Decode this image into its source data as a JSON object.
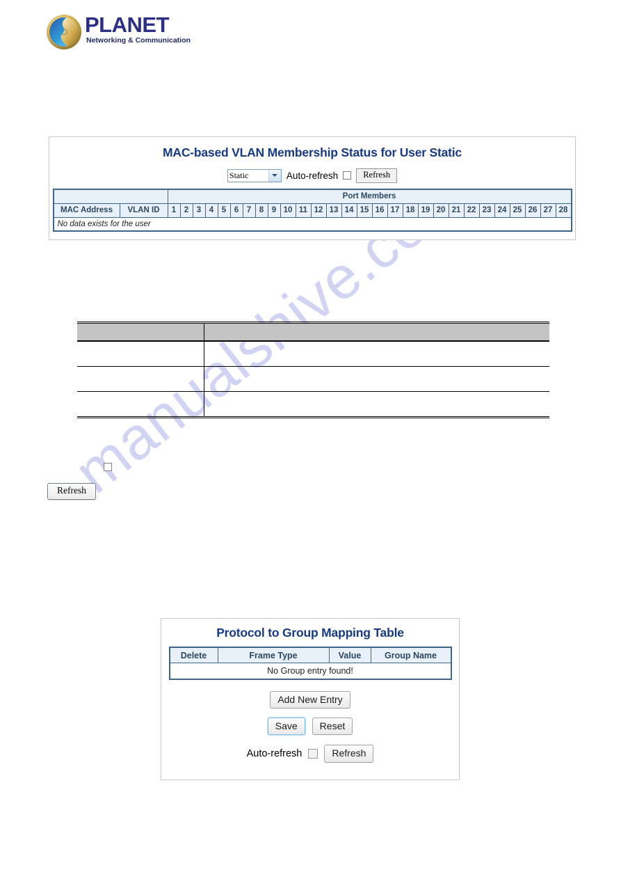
{
  "brand": {
    "name": "PLANET",
    "tagline": "Networking & Communication",
    "logo_icon": "planet-globe-logo",
    "brand_color": "#2b2f86",
    "accent_color": "#163a86"
  },
  "watermark": {
    "text": "manualshive.com",
    "color": "#c9ccf0"
  },
  "mac_vlan_panel": {
    "title": "MAC-based VLAN Membership Status for User Static",
    "user_select": {
      "selected": "Static",
      "options": [
        "Static"
      ],
      "icon": "chevron-down-icon"
    },
    "auto_refresh_label": "Auto-refresh",
    "auto_refresh_checked": false,
    "refresh_label": "Refresh",
    "table": {
      "group_header": "Port Members",
      "columns": [
        "MAC Address",
        "VLAN ID"
      ],
      "ports": [
        "1",
        "2",
        "3",
        "4",
        "5",
        "6",
        "7",
        "8",
        "9",
        "10",
        "11",
        "12",
        "13",
        "14",
        "15",
        "16",
        "17",
        "18",
        "19",
        "20",
        "21",
        "22",
        "23",
        "24",
        "25",
        "26",
        "27",
        "28"
      ],
      "empty_message": "No data exists for the user",
      "rows": []
    }
  },
  "spec_table": {
    "header_cells": [
      "",
      ""
    ],
    "rows": [
      [
        "",
        ""
      ],
      [
        "",
        ""
      ],
      [
        "",
        ""
      ]
    ]
  },
  "lone_controls": {
    "checkbox_checked": false,
    "refresh_label": "Refresh"
  },
  "protocol_panel": {
    "title": "Protocol to Group Mapping Table",
    "table": {
      "columns": [
        "Delete",
        "Frame Type",
        "Value",
        "Group Name"
      ],
      "empty_message": "No Group entry found!",
      "rows": []
    },
    "add_new_entry_label": "Add New Entry",
    "save_label": "Save",
    "reset_label": "Reset",
    "auto_refresh_label": "Auto-refresh",
    "auto_refresh_checked": false,
    "refresh_label": "Refresh"
  }
}
